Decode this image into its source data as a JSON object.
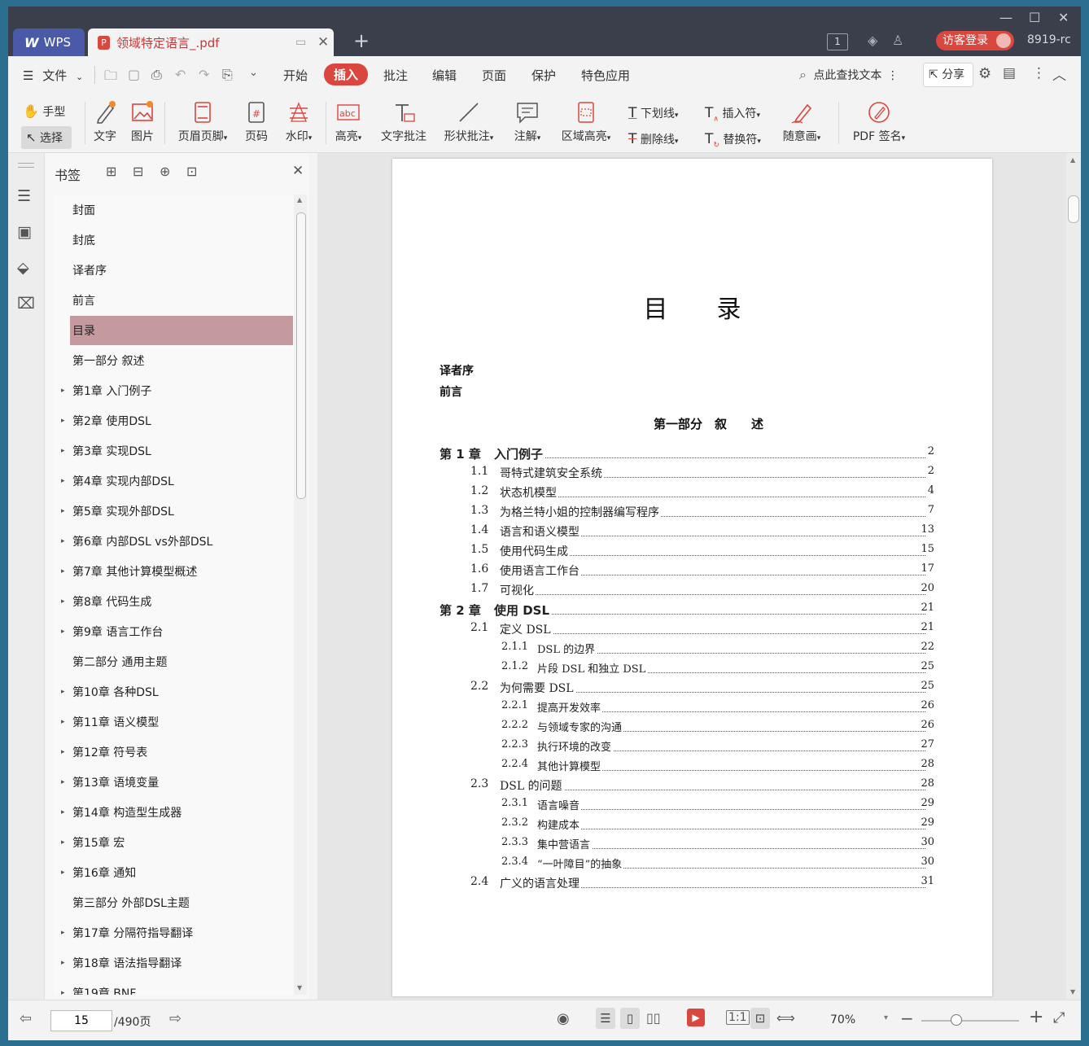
{
  "window": {
    "app_tab": "WPS",
    "doc_tab": "领域特定语言_.pdf",
    "new_tab_symbol": "+",
    "page_badge": "1",
    "login_label": "访客登录",
    "user_id": "8919-rc"
  },
  "menubar": {
    "file": "文件",
    "items": [
      "开始",
      "插入",
      "批注",
      "编辑",
      "页面",
      "保护",
      "特色应用"
    ],
    "search_label": "点此查找文本",
    "share_label": "分享"
  },
  "ribbon": {
    "hand": "手型",
    "select": "选择",
    "text": "文字",
    "image": "图片",
    "header_footer": "页眉页脚",
    "page_num": "页码",
    "watermark": "水印",
    "highlight": "高亮",
    "text_note": "文字批注",
    "shape_note": "形状批注",
    "annotation": "注解",
    "area_highlight": "区域高亮",
    "underline": "下划线",
    "strikethrough": "删除线",
    "insert_mark": "插入符",
    "replace_mark": "替换符",
    "freehand": "随意画",
    "pdf_sign": "PDF 签名"
  },
  "bookmarks": {
    "title": "书签",
    "items": [
      {
        "label": "封面",
        "expandable": false
      },
      {
        "label": "封底",
        "expandable": false
      },
      {
        "label": "译者序",
        "expandable": false
      },
      {
        "label": "前言",
        "expandable": false
      },
      {
        "label": "目录",
        "expandable": false,
        "selected": true
      },
      {
        "label": "第一部分 叙述",
        "expandable": false
      },
      {
        "label": "第1章 入门例子",
        "expandable": true
      },
      {
        "label": "第2章 使用DSL",
        "expandable": true
      },
      {
        "label": "第3章 实现DSL",
        "expandable": true
      },
      {
        "label": "第4章 实现内部DSL",
        "expandable": true
      },
      {
        "label": "第5章 实现外部DSL",
        "expandable": true
      },
      {
        "label": "第6章 内部DSL vs外部DSL",
        "expandable": true
      },
      {
        "label": "第7章 其他计算模型概述",
        "expandable": true
      },
      {
        "label": "第8章 代码生成",
        "expandable": true
      },
      {
        "label": "第9章 语言工作台",
        "expandable": true
      },
      {
        "label": "第二部分 通用主题",
        "expandable": false
      },
      {
        "label": "第10章 各种DSL",
        "expandable": true
      },
      {
        "label": "第11章 语义模型",
        "expandable": true
      },
      {
        "label": "第12章 符号表",
        "expandable": true
      },
      {
        "label": "第13章 语境变量",
        "expandable": true
      },
      {
        "label": "第14章 构造型生成器",
        "expandable": true
      },
      {
        "label": "第15章 宏",
        "expandable": true
      },
      {
        "label": "第16章 通知",
        "expandable": true
      },
      {
        "label": "第三部分 外部DSL主题",
        "expandable": false
      },
      {
        "label": "第17章 分隔符指导翻译",
        "expandable": true
      },
      {
        "label": "第18章 语法指导翻译",
        "expandable": true
      },
      {
        "label": "第19章 BNF",
        "expandable": true
      }
    ]
  },
  "document": {
    "title": "目　　录",
    "front_matter": [
      "译者序",
      "前言"
    ],
    "part_title": "第一部分　叙　　述",
    "entries": [
      {
        "level": 0,
        "num": "第 1 章",
        "title": "入门例子",
        "page": "2"
      },
      {
        "level": 1,
        "num": "1.1",
        "title": "哥特式建筑安全系统",
        "page": "2"
      },
      {
        "level": 1,
        "num": "1.2",
        "title": "状态机模型",
        "page": "4"
      },
      {
        "level": 1,
        "num": "1.3",
        "title": "为格兰特小姐的控制器编写程序",
        "page": "7"
      },
      {
        "level": 1,
        "num": "1.4",
        "title": "语言和语义模型",
        "page": "13"
      },
      {
        "level": 1,
        "num": "1.5",
        "title": "使用代码生成",
        "page": "15"
      },
      {
        "level": 1,
        "num": "1.6",
        "title": "使用语言工作台",
        "page": "17"
      },
      {
        "level": 1,
        "num": "1.7",
        "title": "可视化",
        "page": "20"
      },
      {
        "level": 0,
        "num": "第 2 章",
        "title": "使用 DSL",
        "page": "21"
      },
      {
        "level": 1,
        "num": "2.1",
        "title": "定义 DSL",
        "page": "21"
      },
      {
        "level": 2,
        "num": "2.1.1",
        "title": "DSL 的边界",
        "page": "22"
      },
      {
        "level": 2,
        "num": "2.1.2",
        "title": "片段 DSL 和独立 DSL",
        "page": "25"
      },
      {
        "level": 1,
        "num": "2.2",
        "title": "为何需要 DSL",
        "page": "25"
      },
      {
        "level": 2,
        "num": "2.2.1",
        "title": "提高开发效率",
        "page": "26"
      },
      {
        "level": 2,
        "num": "2.2.2",
        "title": "与领域专家的沟通",
        "page": "26"
      },
      {
        "level": 2,
        "num": "2.2.3",
        "title": "执行环境的改变",
        "page": "27"
      },
      {
        "level": 2,
        "num": "2.2.4",
        "title": "其他计算模型",
        "page": "28"
      },
      {
        "level": 1,
        "num": "2.3",
        "title": "DSL 的问题",
        "page": "28"
      },
      {
        "level": 2,
        "num": "2.3.1",
        "title": "语言噪音",
        "page": "29"
      },
      {
        "level": 2,
        "num": "2.3.2",
        "title": "构建成本",
        "page": "29"
      },
      {
        "level": 2,
        "num": "2.3.3",
        "title": "集中营语言",
        "page": "30"
      },
      {
        "level": 2,
        "num": "2.3.4",
        "title": "“一叶障目”的抽象",
        "page": "30"
      },
      {
        "level": 1,
        "num": "2.4",
        "title": "广义的语言处理",
        "page": "31"
      }
    ]
  },
  "status": {
    "page_current": "15",
    "page_total": "/490页",
    "zoom": "70%"
  },
  "colors": {
    "accent": "#d9473f",
    "titlebar": "#3a3f4b",
    "wps_tab": "#4a5aa8",
    "bookmark_selected": "#c59a9f"
  }
}
